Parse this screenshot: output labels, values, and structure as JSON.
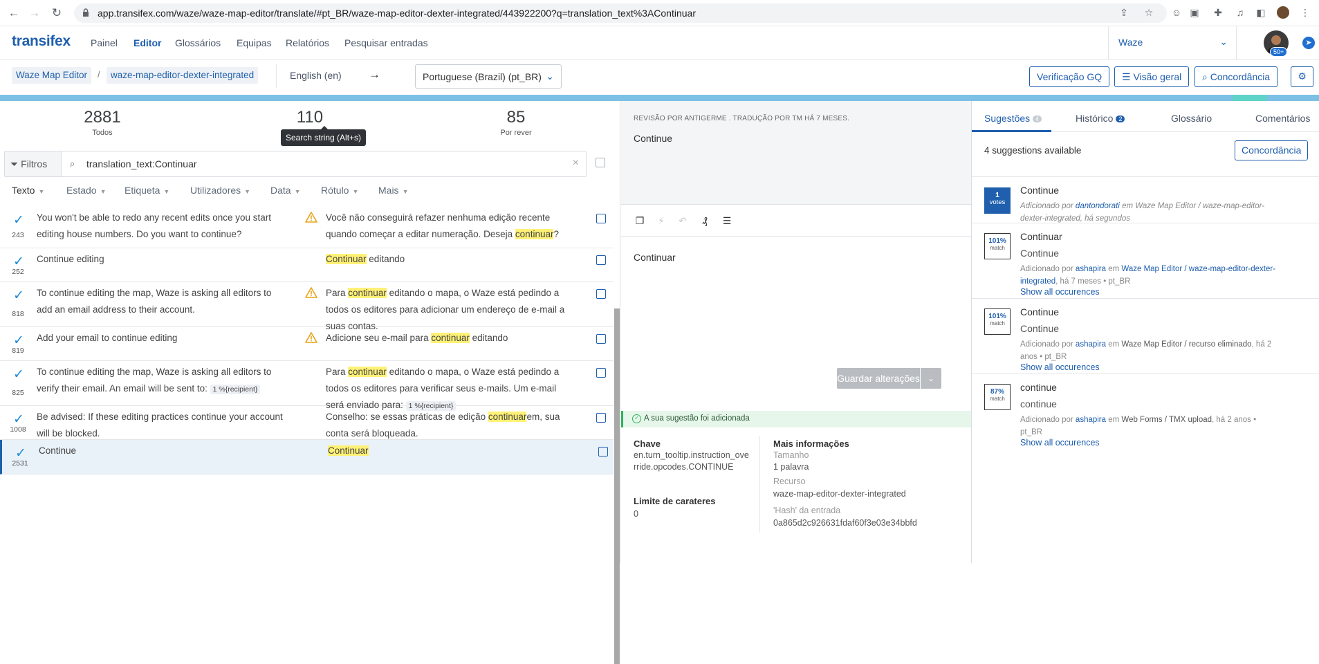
{
  "browser": {
    "url": "app.transifex.com/waze/waze-map-editor/translate/#pt_BR/waze-map-editor-dexter-integrated/443922200?q=translation_text%3AContinuar"
  },
  "header": {
    "logo": "transifex",
    "nav": [
      "Painel",
      "Editor",
      "Glossários",
      "Equipas",
      "Relatórios",
      "Pesquisar entradas"
    ],
    "org": "Waze",
    "avatar_badge": "50+"
  },
  "subheader": {
    "crumb_project": "Waze Map Editor",
    "crumb_sep": "/",
    "crumb_resource": "waze-map-editor-dexter-integrated",
    "source_lang": "English (en)",
    "arrow": "→",
    "target_lang": "Portuguese (Brazil) (pt_BR)",
    "btn_qa": "Verificação GQ",
    "btn_overview": "Visão geral",
    "btn_concordance": "Concordância"
  },
  "stats": {
    "all_count": "2881",
    "all_label": "Todos",
    "mid_count": "110",
    "review_count": "85",
    "review_label": "Por rever",
    "tooltip": "Search string (Alt+s)"
  },
  "filter": {
    "label": "Filtros",
    "query": "translation_text:Continuar",
    "columns": [
      "Texto",
      "Estado",
      "Etiqueta",
      "Utilizadores",
      "Data",
      "Rótulo",
      "Mais"
    ]
  },
  "rows": [
    {
      "num": "243",
      "src": "You won't be able to redo any recent edits once you start editing house numbers. Do you want to continue?",
      "warn": true,
      "tgt": [
        "Você não conseguirá refazer nenhuma edição recente quando começar a editar numeração. Deseja ",
        "continuar",
        "?"
      ]
    },
    {
      "num": "252",
      "src": "Continue editing",
      "warn": false,
      "tgt": [
        "",
        "Continuar",
        " editando"
      ]
    },
    {
      "num": "818",
      "src": "To continue editing the map, Waze is asking all editors to add an email address to their account.",
      "warn": true,
      "tgt": [
        "Para ",
        "continuar",
        " editando o mapa, o Waze está pedindo a todos os editores para adicionar um endereço de e-mail a suas contas."
      ]
    },
    {
      "num": "819",
      "src": "Add your email to continue editing",
      "warn": true,
      "tgt": [
        "Adicione seu e-mail para ",
        "continuar",
        " editando"
      ]
    },
    {
      "num": "825",
      "src": "To continue editing the map, Waze is asking all editors to verify their email. An email will be sent to: ",
      "src_tag": "1 %{recipient}",
      "warn": false,
      "tgt": [
        "Para ",
        "continuar",
        " editando o mapa, o Waze está pedindo a todos os editores para verificar seus e-mails. Um e-mail será enviado para: "
      ],
      "tgt_tag": "1 %{recipient}"
    },
    {
      "num": "1008",
      "src": "Be advised: If these editing practices continue your account will be blocked.",
      "warn": false,
      "tgt": [
        "Conselho: se essas práticas de edição ",
        "continuar",
        "em, sua conta será bloqueada."
      ]
    },
    {
      "num": "2531",
      "src": "Continue",
      "warn": false,
      "tgt": [
        "",
        "Continuar",
        ""
      ],
      "selected": true
    }
  ],
  "middle": {
    "review_meta": "REVISÃO POR ANTIGERME . TRADUÇÃO POR TM HÁ 7 MESES.",
    "source": "Continue",
    "translation": "Continuar",
    "save_label": "Guardar alterações",
    "save_chevron": "⌄",
    "notice": "A sua sugestão foi adicionada",
    "key_label": "Chave",
    "key_value": "en.turn_tooltip.instruction_override.opcodes.CONTINUE",
    "limit_label": "Limite de carateres",
    "limit_value": "0",
    "more_label": "Mais informações",
    "size_label": "Tamanho",
    "size_value": "1 palavra",
    "resource_label": "Recurso",
    "resource_value": "waze-map-editor-dexter-integrated",
    "hash_label": "'Hash' da entrada",
    "hash_value": "0a865d2c926631fdaf60f3e03e34bbfd"
  },
  "right": {
    "tabs": [
      {
        "label": "Sugestões",
        "badge": "4"
      },
      {
        "label": "Histórico",
        "badge": "2"
      },
      {
        "label": "Glossário"
      },
      {
        "label": "Comentários"
      }
    ],
    "count_text": "4 suggestions available",
    "concordance_btn": "Concordância",
    "show_all": "Show all occurences",
    "suggestions": [
      {
        "votes": "1",
        "votes_label": "votes",
        "text": "Continue",
        "by_prefix": "Adicionado por ",
        "user": "dantondorati",
        "in": " em ",
        "resource": "Waze Map Editor / waze-map-editor-dexter-integrated",
        "time": ", há segundos"
      },
      {
        "match": "101%",
        "match_label": "match",
        "text": "Continuar",
        "src": "Continue",
        "by_prefix": "Adicionado por ",
        "user": "ashapira",
        "in": " em ",
        "resource": "Waze Map Editor / waze-map-editor-dexter-integrated",
        "time": ", há 7 meses • pt_BR"
      },
      {
        "match": "101%",
        "match_label": "match",
        "text": "Continue",
        "src": "Continue",
        "by_prefix": "Adicionado por ",
        "user": "ashapira",
        "in": " em ",
        "resource": "Waze Map Editor / recurso eliminado",
        "time": ", há 2 anos • pt_BR"
      },
      {
        "match": "87%",
        "match_label": "match",
        "text": "continue",
        "src": "continue",
        "by_prefix": "Adicionado por ",
        "user": "ashapira",
        "in": " em ",
        "resource": "Web Forms / TMX upload",
        "time": ", há 2 anos • pt_BR"
      }
    ]
  },
  "colors": {
    "accent": "#1f5fae",
    "check": "#1f8ad6",
    "highlight": "#fff176",
    "progress": "#7cc0e6",
    "success": "#2fb35a"
  }
}
